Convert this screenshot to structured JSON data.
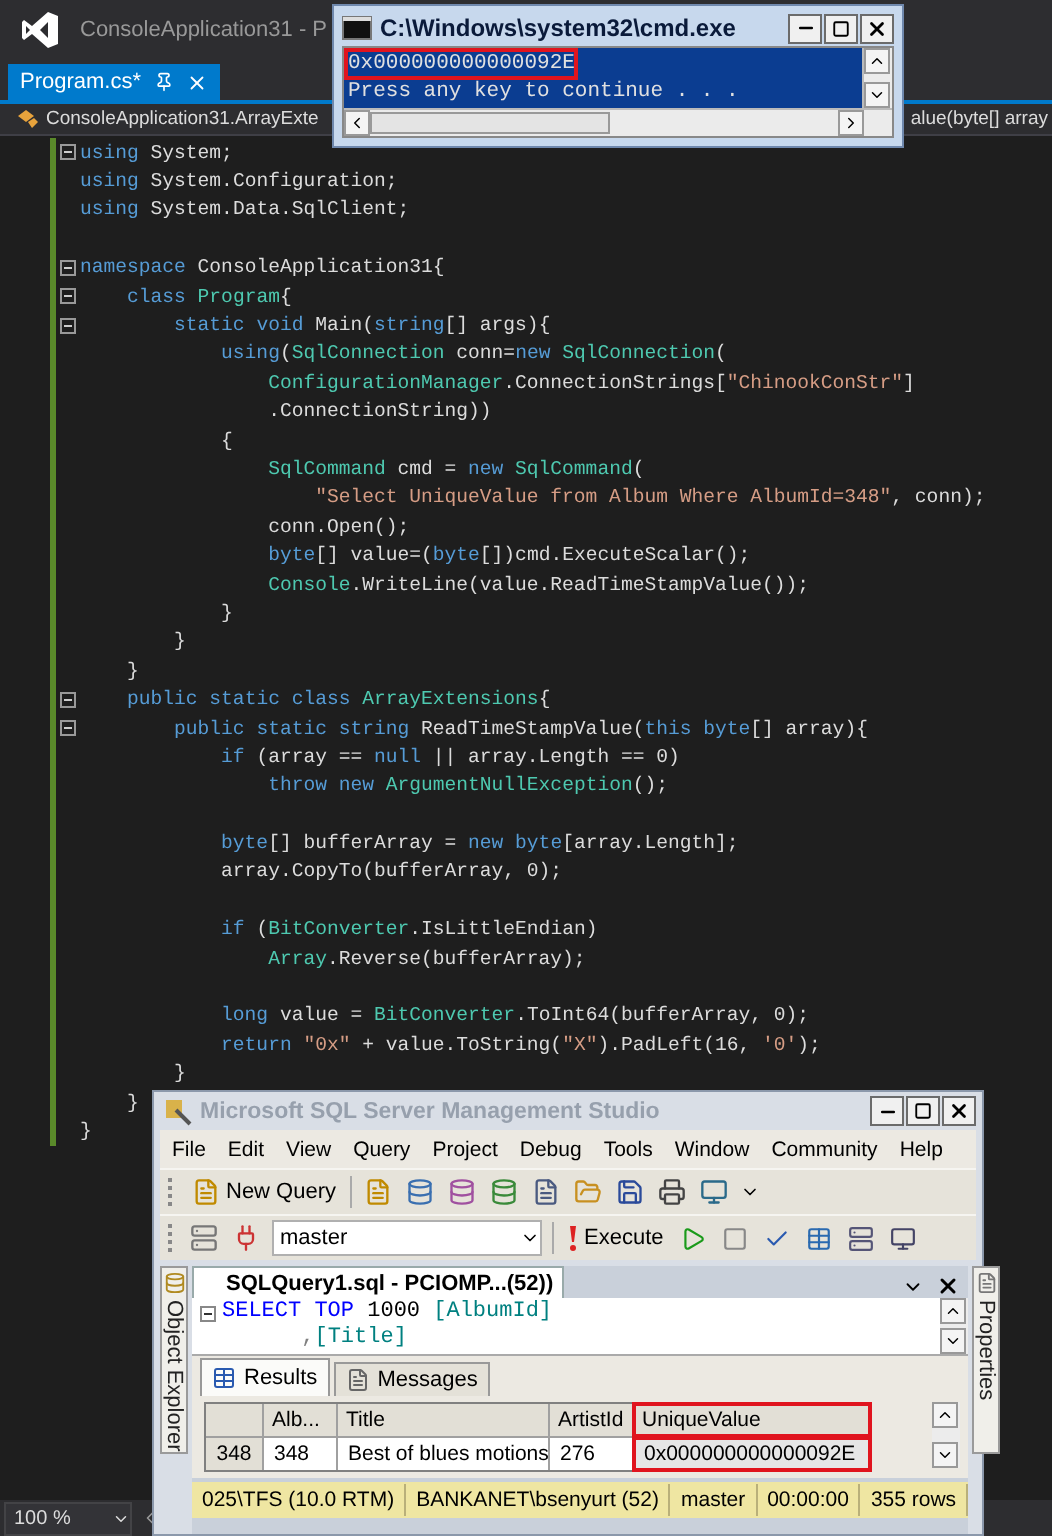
{
  "vs": {
    "title": "ConsoleApplication31 - P",
    "tab": {
      "label": "Program.cs*",
      "selected": true
    },
    "nav_left": "ConsoleApplication31.ArrayExte",
    "nav_right": "alue(byte[] array",
    "zoom": "100 %",
    "code": [
      {
        "fold": true,
        "tokens": [
          {
            "text": "using",
            "kind": "kw"
          },
          {
            "text": " System;",
            "kind": "plain"
          }
        ]
      },
      {
        "tokens": [
          {
            "text": "using",
            "kind": "kw"
          },
          {
            "text": " System.Configuration;",
            "kind": "plain"
          }
        ]
      },
      {
        "tokens": [
          {
            "text": "using",
            "kind": "kw"
          },
          {
            "text": " System.Data.SqlClient;",
            "kind": "plain"
          }
        ]
      },
      {
        "blank_before": true,
        "fold": true,
        "tokens": [
          {
            "text": "namespace",
            "kind": "kw"
          },
          {
            "text": " ConsoleApplication31{",
            "kind": "plain"
          }
        ]
      },
      {
        "fold": true,
        "tokens": [
          {
            "text": "    class",
            "kind": "kw"
          },
          {
            "text": " Program",
            "kind": "type"
          },
          {
            "text": "{",
            "kind": "plain"
          }
        ]
      },
      {
        "fold": true,
        "tokens": [
          {
            "text": "        static",
            "kind": "kw"
          },
          {
            "text": " void",
            "kind": "kw"
          },
          {
            "text": " Main(",
            "kind": "plain"
          },
          {
            "text": "string",
            "kind": "kw"
          },
          {
            "text": "[] args){",
            "kind": "plain"
          }
        ]
      },
      {
        "tokens": [
          {
            "text": "            using",
            "kind": "kw"
          },
          {
            "text": "(",
            "kind": "plain"
          },
          {
            "text": "SqlConnection",
            "kind": "type"
          },
          {
            "text": " conn=",
            "kind": "plain"
          },
          {
            "text": "new",
            "kind": "kw"
          },
          {
            "text": " SqlConnection",
            "kind": "type"
          },
          {
            "text": "(",
            "kind": "plain"
          }
        ]
      },
      {
        "tokens": [
          {
            "text": "                ConfigurationManager",
            "kind": "type"
          },
          {
            "text": ".ConnectionStrings[",
            "kind": "plain"
          },
          {
            "text": "\"ChinookConStr\"",
            "kind": "str"
          },
          {
            "text": "]",
            "kind": "plain"
          }
        ]
      },
      {
        "tokens": [
          {
            "text": "                .ConnectionString))",
            "kind": "plain"
          }
        ]
      },
      {
        "tokens": [
          {
            "text": "            {",
            "kind": "plain"
          }
        ]
      },
      {
        "tokens": [
          {
            "text": "                SqlCommand",
            "kind": "type"
          },
          {
            "text": " cmd = ",
            "kind": "plain"
          },
          {
            "text": "new",
            "kind": "kw"
          },
          {
            "text": " SqlCommand",
            "kind": "type"
          },
          {
            "text": "(",
            "kind": "plain"
          }
        ]
      },
      {
        "tokens": [
          {
            "text": "                    \"Select UniqueValue from Album Where AlbumId=348\"",
            "kind": "str"
          },
          {
            "text": ", conn);",
            "kind": "plain"
          }
        ]
      },
      {
        "tokens": [
          {
            "text": "                conn.Open();",
            "kind": "plain"
          }
        ]
      },
      {
        "tokens": [
          {
            "text": "                byte",
            "kind": "kw"
          },
          {
            "text": "[] value=(",
            "kind": "plain"
          },
          {
            "text": "byte",
            "kind": "kw"
          },
          {
            "text": "[])cmd.ExecuteScalar();",
            "kind": "plain"
          }
        ]
      },
      {
        "tokens": [
          {
            "text": "                Console",
            "kind": "type"
          },
          {
            "text": ".WriteLine(value.ReadTimeStampValue());",
            "kind": "plain"
          }
        ]
      },
      {
        "tokens": [
          {
            "text": "            }",
            "kind": "plain"
          }
        ]
      },
      {
        "tokens": [
          {
            "text": "        }",
            "kind": "plain"
          }
        ]
      },
      {
        "tokens": [
          {
            "text": "    }",
            "kind": "plain"
          }
        ]
      },
      {
        "fold": true,
        "tokens": [
          {
            "text": "    public",
            "kind": "kw"
          },
          {
            "text": " static",
            "kind": "kw"
          },
          {
            "text": " class",
            "kind": "kw"
          },
          {
            "text": " ArrayExtensions",
            "kind": "type"
          },
          {
            "text": "{",
            "kind": "plain"
          }
        ]
      },
      {
        "fold": true,
        "tokens": [
          {
            "text": "        public",
            "kind": "kw"
          },
          {
            "text": " static",
            "kind": "kw"
          },
          {
            "text": " string",
            "kind": "kw"
          },
          {
            "text": " ReadTimeStampValue(",
            "kind": "plain"
          },
          {
            "text": "this",
            "kind": "kw"
          },
          {
            "text": " byte",
            "kind": "kw"
          },
          {
            "text": "[] array){",
            "kind": "plain"
          }
        ]
      },
      {
        "tokens": [
          {
            "text": "            if",
            "kind": "kw"
          },
          {
            "text": " (array == ",
            "kind": "plain"
          },
          {
            "text": "null",
            "kind": "kw"
          },
          {
            "text": " || array.Length == 0)",
            "kind": "plain"
          }
        ]
      },
      {
        "tokens": [
          {
            "text": "                throw",
            "kind": "kw"
          },
          {
            "text": " new",
            "kind": "kw"
          },
          {
            "text": " ArgumentNullException",
            "kind": "type"
          },
          {
            "text": "();",
            "kind": "plain"
          }
        ]
      },
      {
        "blank_before": true,
        "tokens": [
          {
            "text": "            byte",
            "kind": "kw"
          },
          {
            "text": "[] bufferArray = ",
            "kind": "plain"
          },
          {
            "text": "new",
            "kind": "kw"
          },
          {
            "text": " byte",
            "kind": "kw"
          },
          {
            "text": "[array.Length];",
            "kind": "plain"
          }
        ]
      },
      {
        "tokens": [
          {
            "text": "            array.CopyTo(bufferArray, 0);",
            "kind": "plain"
          }
        ]
      },
      {
        "blank_before": true,
        "tokens": [
          {
            "text": "            if",
            "kind": "kw"
          },
          {
            "text": " (",
            "kind": "plain"
          },
          {
            "text": "BitConverter",
            "kind": "type"
          },
          {
            "text": ".IsLittleEndian)",
            "kind": "plain"
          }
        ]
      },
      {
        "tokens": [
          {
            "text": "                Array",
            "kind": "type"
          },
          {
            "text": ".Reverse(bufferArray);",
            "kind": "plain"
          }
        ]
      },
      {
        "blank_before": true,
        "tokens": [
          {
            "text": "            long",
            "kind": "kw"
          },
          {
            "text": " value = ",
            "kind": "plain"
          },
          {
            "text": "BitConverter",
            "kind": "type"
          },
          {
            "text": ".ToInt64(bufferArray, 0);",
            "kind": "plain"
          }
        ]
      },
      {
        "tokens": [
          {
            "text": "            return",
            "kind": "kw"
          },
          {
            "text": " \"0x\"",
            "kind": "str"
          },
          {
            "text": " + value.ToString(",
            "kind": "plain"
          },
          {
            "text": "\"X\"",
            "kind": "str"
          },
          {
            "text": ").PadLeft(16, ",
            "kind": "plain"
          },
          {
            "text": "'0'",
            "kind": "str"
          },
          {
            "text": ");",
            "kind": "plain"
          }
        ]
      },
      {
        "tokens": [
          {
            "text": "        }",
            "kind": "plain"
          }
        ]
      },
      {
        "tokens": [
          {
            "text": "    }",
            "kind": "plain"
          }
        ]
      },
      {
        "tokens": [
          {
            "text": "}",
            "kind": "plain"
          }
        ]
      }
    ]
  },
  "console": {
    "title": "C:\\Windows\\system32\\cmd.exe",
    "lines": [
      {
        "text": "0x000000000000092E",
        "highlighted": true
      },
      {
        "text": "Press any key to continue . . .",
        "highlighted": false
      }
    ]
  },
  "ssms": {
    "title": "Microsoft SQL Server Management Studio",
    "menu": [
      "File",
      "Edit",
      "View",
      "Query",
      "Project",
      "Debug",
      "Tools",
      "Window",
      "Community",
      "Help"
    ],
    "new_query": "New Query",
    "database": "master",
    "execute": "Execute",
    "side_left": "Object Explorer",
    "side_right": "Properties",
    "document_tab": "SQLQuery1.sql - PCIOMP...(52))",
    "query": [
      {
        "fold": true,
        "tokens": [
          {
            "text": "SELECT",
            "kind": "kw"
          },
          {
            "text": " TOP",
            "kind": "kw"
          },
          {
            "text": " 1000 ",
            "kind": "plain"
          },
          {
            "text": "[AlbumId]",
            "kind": "ident"
          }
        ]
      },
      {
        "tokens": [
          {
            "text": "      ,",
            "kind": "op"
          },
          {
            "text": "[Title]",
            "kind": "ident"
          }
        ]
      }
    ],
    "result_tabs": [
      {
        "label": "Results",
        "selected": true
      },
      {
        "label": "Messages",
        "selected": false
      }
    ],
    "grid": {
      "columns": [
        {
          "label": "Alb...",
          "highlighted": false
        },
        {
          "label": "Title",
          "highlighted": false
        },
        {
          "label": "ArtistId",
          "highlighted": false
        },
        {
          "label": "UniqueValue",
          "highlighted": true
        }
      ],
      "rows": [
        {
          "header": "348",
          "cells": [
            {
              "text": "348",
              "selected": false
            },
            {
              "text": "Best of blues motions",
              "selected": false
            },
            {
              "text": "276",
              "selected": false
            },
            {
              "text": "0x000000000000092E",
              "selected": true
            }
          ]
        }
      ]
    },
    "status": [
      "025\\TFS (10.0 RTM)",
      "BANKANET\\bsenyurt (52)",
      "master",
      "00:00:00",
      "355 rows"
    ]
  }
}
